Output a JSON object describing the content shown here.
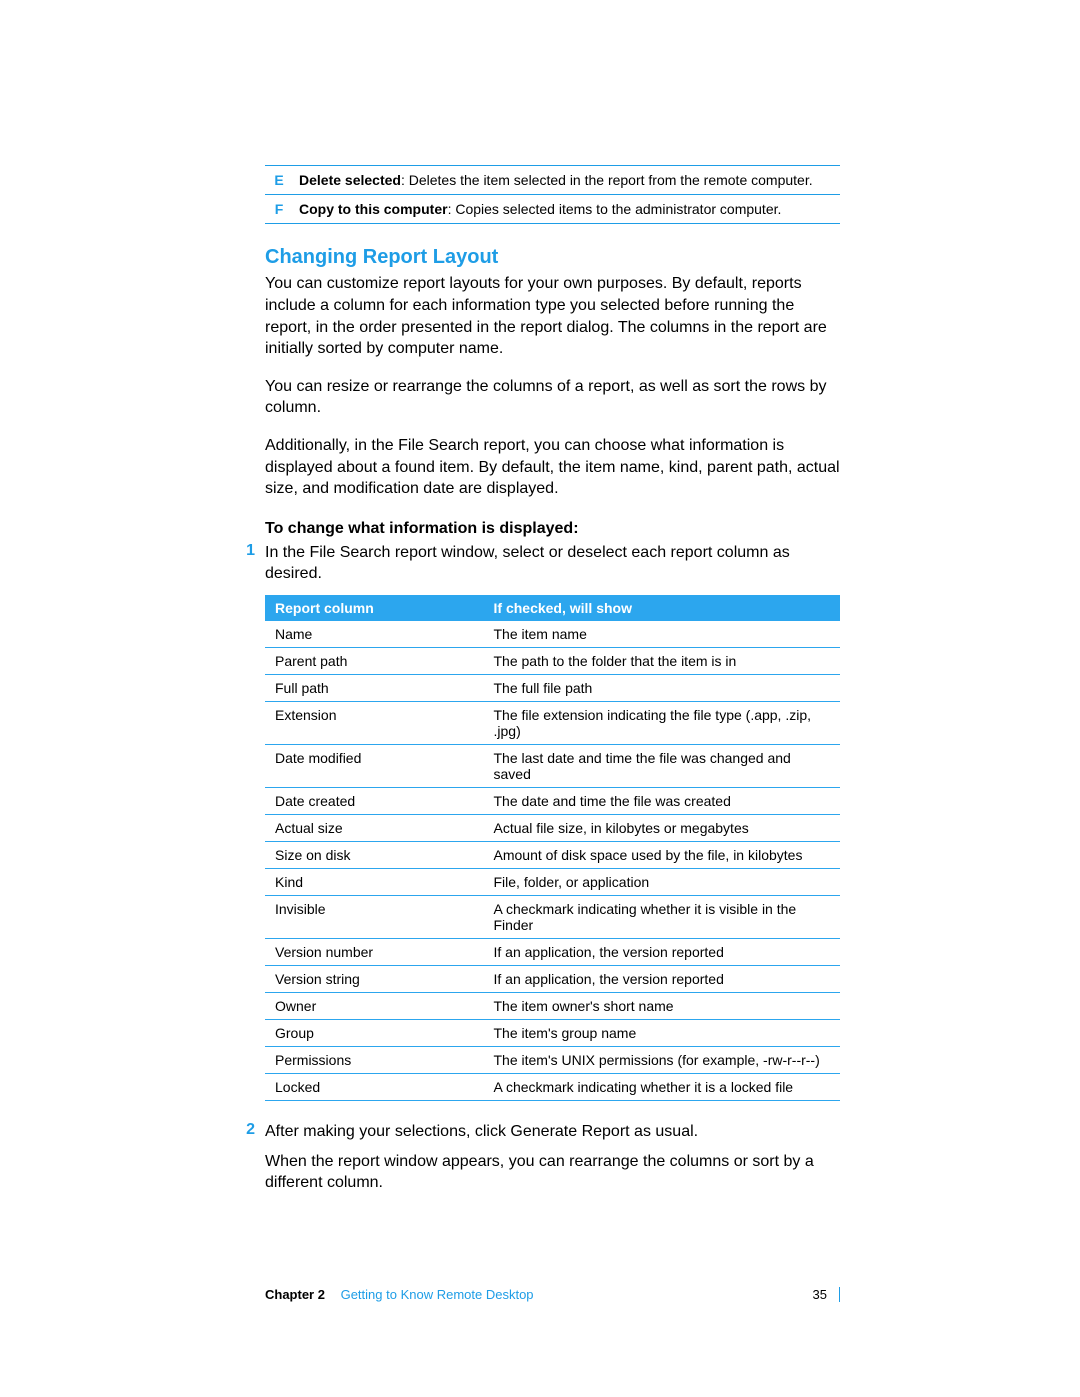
{
  "callouts": [
    {
      "letter": "E",
      "label": "Delete selected",
      "text": ":  Deletes the item selected in the report from the remote computer."
    },
    {
      "letter": "F",
      "label": "Copy to this computer",
      "text": ":  Copies selected items to the administrator computer."
    }
  ],
  "heading": "Changing Report Layout",
  "paragraphs": {
    "p1": "You can customize report layouts for your own purposes. By default, reports include a column for each information type you selected before running the report, in the order presented in the report dialog. The columns in the report are initially sorted by computer name.",
    "p2": "You can resize or rearrange the columns of a report, as well as sort the rows by column.",
    "p3": "Additionally, in the File Search report, you can choose what information is displayed about a found item. By default, the item name, kind, parent path, actual size, and modification date are displayed."
  },
  "subhead": "To change what information is displayed:",
  "step1": {
    "num": "1",
    "text": "In the File Search report window, select or deselect each report column as desired."
  },
  "table": {
    "headers": {
      "col1": "Report column",
      "col2": "If checked, will show"
    },
    "rows": [
      {
        "c1": "Name",
        "c2": "The item name"
      },
      {
        "c1": "Parent path",
        "c2": "The path to the folder that the item is in"
      },
      {
        "c1": "Full path",
        "c2": "The full file path"
      },
      {
        "c1": "Extension",
        "c2": "The file extension indicating the file type (.app, .zip, .jpg)"
      },
      {
        "c1": "Date modified",
        "c2": "The last date and time the file was changed and saved"
      },
      {
        "c1": "Date created",
        "c2": "The date and time the file was created"
      },
      {
        "c1": "Actual size",
        "c2": "Actual file size, in kilobytes or megabytes"
      },
      {
        "c1": "Size on disk",
        "c2": "Amount of disk space used by the file, in kilobytes"
      },
      {
        "c1": "Kind",
        "c2": "File, folder, or application"
      },
      {
        "c1": "Invisible",
        "c2": "A checkmark indicating whether it is visible in the Finder"
      },
      {
        "c1": "Version number",
        "c2": "If an application, the version reported"
      },
      {
        "c1": "Version string",
        "c2": "If an application, the version reported"
      },
      {
        "c1": "Owner",
        "c2": "The item owner's short name"
      },
      {
        "c1": "Group",
        "c2": "The item's group name"
      },
      {
        "c1": "Permissions",
        "c2": "The item's UNIX permissions (for example, -rw-r--r--)"
      },
      {
        "c1": "Locked",
        "c2": "A checkmark indicating whether it is a locked file"
      }
    ]
  },
  "step2": {
    "num": "2",
    "text": "After making your selections, click Generate Report as usual."
  },
  "p4": "When the report window appears, you can rearrange the columns or sort by a different column.",
  "footer": {
    "chapter_label": "Chapter 2",
    "chapter_name": "Getting to Know Remote Desktop",
    "page": "35"
  }
}
